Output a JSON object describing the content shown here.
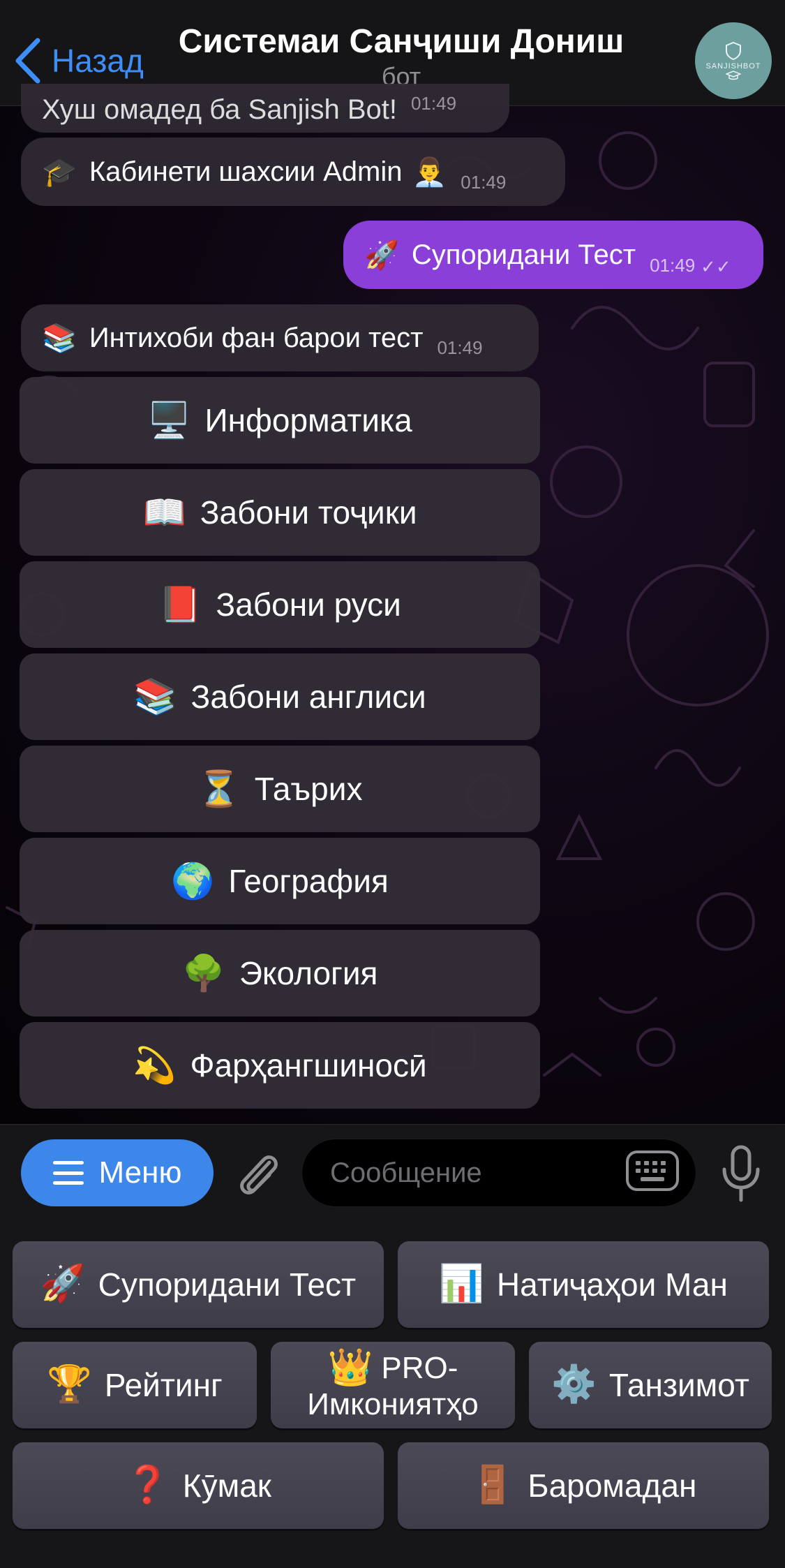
{
  "header": {
    "back_label": "Назад",
    "title": "Системаи Санҷиши Дониш",
    "subtitle": "бот",
    "avatar_text": "SANJISHBOT"
  },
  "messages": [
    {
      "text": "Хуш омадед ба Sanjish Bot!",
      "time": "01:49",
      "emoji": ""
    },
    {
      "text": "Кабинети шахсии Admin",
      "time": "01:49",
      "emoji": "🎓",
      "trailing_emoji": "👨‍💼"
    },
    {
      "text": "Супоридани Тест",
      "time": "01:49",
      "emoji": "🚀",
      "ticks": "✓✓",
      "outgoing": true
    },
    {
      "text": "Интихоби фан барои тест",
      "time": "01:49",
      "emoji": "📚"
    }
  ],
  "inline_keyboard": [
    {
      "emoji": "🖥️",
      "label": "Информатика"
    },
    {
      "emoji": "📖",
      "label": "Забони тоҷики"
    },
    {
      "emoji": "📕",
      "label": "Забони руси"
    },
    {
      "emoji": "📚",
      "label": "Забони англиси"
    },
    {
      "emoji": "⏳",
      "label": "Таърих"
    },
    {
      "emoji": "🌍",
      "label": "География"
    },
    {
      "emoji": "🌳",
      "label": "Экология"
    },
    {
      "emoji": "💫",
      "label": "Фарҳангшиносӣ"
    }
  ],
  "input_bar": {
    "menu_label": "Меню",
    "placeholder": "Сообщение"
  },
  "reply_keyboard": {
    "row1": [
      {
        "emoji": "🚀",
        "label": "Супоридани Тест"
      },
      {
        "emoji": "📊",
        "label": "Натиҷаҳои Ман"
      }
    ],
    "row2": [
      {
        "emoji": "🏆",
        "label": "Рейтинг"
      },
      {
        "emoji": "👑",
        "label_line1": "PRO-",
        "label_line2": "Имкониятҳо"
      },
      {
        "emoji": "⚙️",
        "label": "Танзимот"
      }
    ],
    "row3": [
      {
        "emoji": "❓",
        "label": "Кӯмак"
      },
      {
        "emoji": "🚪",
        "label": "Баромадан"
      }
    ]
  },
  "colors": {
    "accent_blue": "#3d86ea",
    "outgoing_bubble": "#8b3fd9",
    "incoming_bubble": "#302a34"
  }
}
